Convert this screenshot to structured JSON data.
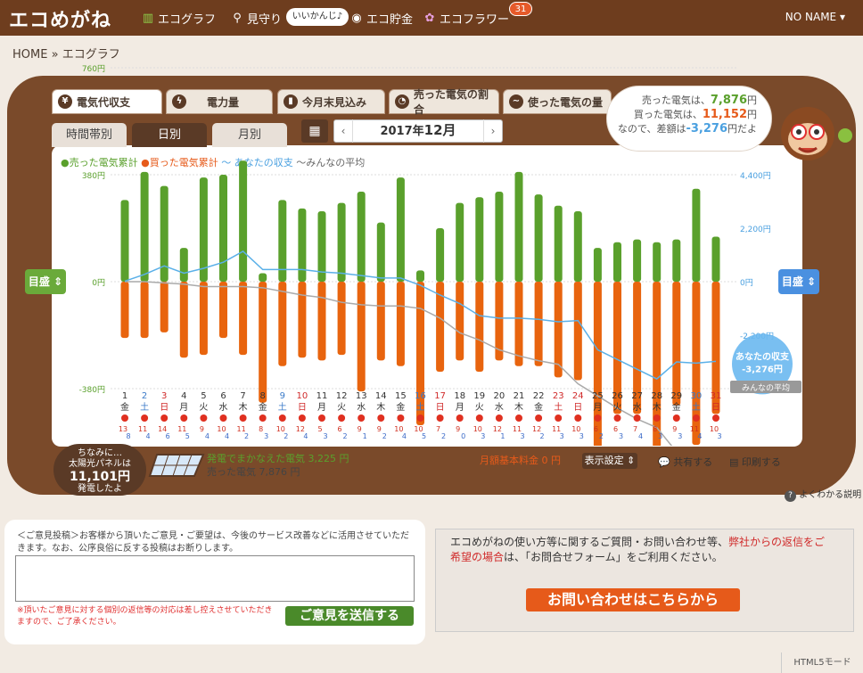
{
  "header": {
    "logo": "エコめがね",
    "nav": [
      {
        "label": "エコグラフ",
        "icon": "bar-chart-icon"
      },
      {
        "label": "見守り",
        "icon": "magnifier-icon"
      },
      {
        "label": "エコ貯金",
        "icon": "coin-icon"
      },
      {
        "label": "エコフラワー",
        "icon": "flower-icon"
      }
    ],
    "bubble": "いいかんじ♪",
    "badge": "31",
    "user": "NO NAME"
  },
  "breadcrumb": {
    "home": "HOME",
    "sep": "»",
    "current": "エコグラフ"
  },
  "tabs": [
    {
      "label": "電気代収支",
      "icon": "yen-icon"
    },
    {
      "label": "電力量",
      "icon": "bolt-icon"
    },
    {
      "label": "今月末見込み",
      "icon": "bar-chart-icon"
    },
    {
      "label": "売った電気の割合",
      "icon": "pie-icon"
    },
    {
      "label": "使った電気の量",
      "icon": "wave-icon"
    }
  ],
  "subtabs": [
    "時間帯別",
    "日別",
    "月別"
  ],
  "date": {
    "year": "2017年",
    "month": "12月",
    "prev": "‹",
    "next": "›"
  },
  "cloud": {
    "l1a": "売った電気は、",
    "l1v": "7,876",
    "l1u": "円",
    "l2a": "買った電気は、",
    "l2v": "11,152",
    "l2u": "円",
    "l3a": "なので、差額は",
    "l3v": "-3,276",
    "l3u": "円だよ"
  },
  "legend": {
    "sold": "●売った電気累計",
    "bought": "●買った電気累計",
    "yours": "～ あなたの収支",
    "avg": "～みんなの平均"
  },
  "meter_label": "目盛",
  "chart_data": {
    "type": "bar",
    "left_axis": {
      "ticks": [
        "760円",
        "380円",
        "0円",
        "-380円",
        "-760円"
      ],
      "range": [
        -760,
        760
      ]
    },
    "right_axis": {
      "ticks": [
        "4,400円",
        "2,200円",
        "0円",
        "-2,200円"
      ],
      "range": [
        -4400,
        4400
      ]
    },
    "days": [
      "1",
      "2",
      "3",
      "4",
      "5",
      "6",
      "7",
      "8",
      "9",
      "10",
      "11",
      "12",
      "13",
      "14",
      "15",
      "16",
      "17",
      "18",
      "19",
      "20",
      "21",
      "22",
      "23",
      "24",
      "25",
      "26",
      "27",
      "28",
      "29",
      "30",
      "31"
    ],
    "weekdays": [
      "金",
      "土",
      "日",
      "月",
      "火",
      "水",
      "木",
      "金",
      "土",
      "日",
      "月",
      "火",
      "水",
      "木",
      "金",
      "土",
      "日",
      "月",
      "火",
      "水",
      "木",
      "金",
      "土",
      "日",
      "月",
      "火",
      "水",
      "木",
      "金",
      "土",
      "日"
    ],
    "day_colors": [
      "#333",
      "#3a7ac8",
      "#d02a2a",
      "#333",
      "#333",
      "#333",
      "#333",
      "#333",
      "#3a7ac8",
      "#d02a2a",
      "#333",
      "#333",
      "#333",
      "#333",
      "#333",
      "#3a7ac8",
      "#d02a2a",
      "#333",
      "#333",
      "#333",
      "#333",
      "#333",
      "#d02a2a",
      "#d02a2a",
      "#333",
      "#333",
      "#333",
      "#333",
      "#333",
      "#3a7ac8",
      "#d02a2a"
    ],
    "temp_hi": [
      "13",
      "11",
      "14",
      "11",
      "9",
      "10",
      "11",
      "8",
      "10",
      "12",
      "5",
      "6",
      "9",
      "9",
      "10",
      "10",
      "7",
      "9",
      "10",
      "12",
      "11",
      "12",
      "11",
      "10",
      "6",
      "6",
      "7",
      "8",
      "9",
      "11",
      "10"
    ],
    "temp_lo": [
      "8",
      "4",
      "6",
      "5",
      "4",
      "4",
      "2",
      "3",
      "2",
      "4",
      "3",
      "2",
      "1",
      "2",
      "4",
      "5",
      "2",
      "0",
      "3",
      "1",
      "3",
      "2",
      "3",
      "3",
      "2",
      "3",
      "4",
      "3",
      "3",
      "4",
      "3"
    ],
    "sold": [
      290,
      390,
      340,
      120,
      370,
      380,
      430,
      30,
      290,
      260,
      250,
      280,
      320,
      210,
      370,
      40,
      190,
      280,
      300,
      320,
      390,
      310,
      270,
      250,
      120,
      140,
      150,
      140,
      150,
      330,
      160
    ],
    "bought": [
      -200,
      -200,
      -180,
      -270,
      -260,
      -200,
      -260,
      -430,
      -300,
      -270,
      -280,
      -260,
      -390,
      -280,
      -300,
      -510,
      -320,
      -280,
      -320,
      -280,
      -300,
      -300,
      -340,
      -350,
      -680,
      -470,
      -470,
      -760,
      -440,
      -580,
      -470
    ],
    "yours": [
      20,
      300,
      650,
      350,
      550,
      800,
      1250,
      500,
      500,
      500,
      400,
      350,
      250,
      150,
      150,
      -150,
      -550,
      -900,
      -1400,
      -1500,
      -1500,
      -1550,
      -1650,
      -1600,
      -2800,
      -3200,
      -3600,
      -4000,
      -3300,
      -3350,
      -3276
    ],
    "avg": [
      0,
      0,
      -50,
      -100,
      -200,
      -200,
      -200,
      -250,
      -400,
      -550,
      -650,
      -850,
      -950,
      -1000,
      -1000,
      -1100,
      -1500,
      -2100,
      -2400,
      -2800,
      -3050,
      -3250,
      -3400,
      -4200,
      -4700,
      -5200,
      -5650,
      -6000,
      -7000,
      -7800,
      -9300
    ],
    "yours_bubble": "あなたの収支\n-3,276円",
    "avg_label": "みんなの平均"
  },
  "solar": {
    "l1": "ちなみに…",
    "l2": "太陽光パネルは",
    "big": "11,101円",
    "l3": "発電したよ"
  },
  "summary": {
    "gen": "発電でまかなえた電気 3,225 円",
    "sold": "売った電気 7,876 円",
    "base": "月額基本料金 0 円",
    "display": "表示設定",
    "share": "共有する",
    "print": "印刷する",
    "help": "よくわかる説明"
  },
  "feedback": {
    "text": "＜ご意見投稿＞お客様から頂いたご意見・ご要望は、今後のサービス改善などに活用させていただきます。なお、公序良俗に反する投稿はお断りします。",
    "note": "※頂いたご意見に対する個別の返信等の対応は差し控えさせていただきますので、ご了承ください。",
    "send": "ご意見を送信する"
  },
  "contact": {
    "p1": "エコめがねの使い方等に関するご質問・お問い合わせ等、",
    "p2": "弊社からの返信をご希望の場合",
    "p3": "は、「お問合せフォーム」をご利用ください。",
    "btn": "お問い合わせはこちらから"
  },
  "html5": "HTML5モード"
}
